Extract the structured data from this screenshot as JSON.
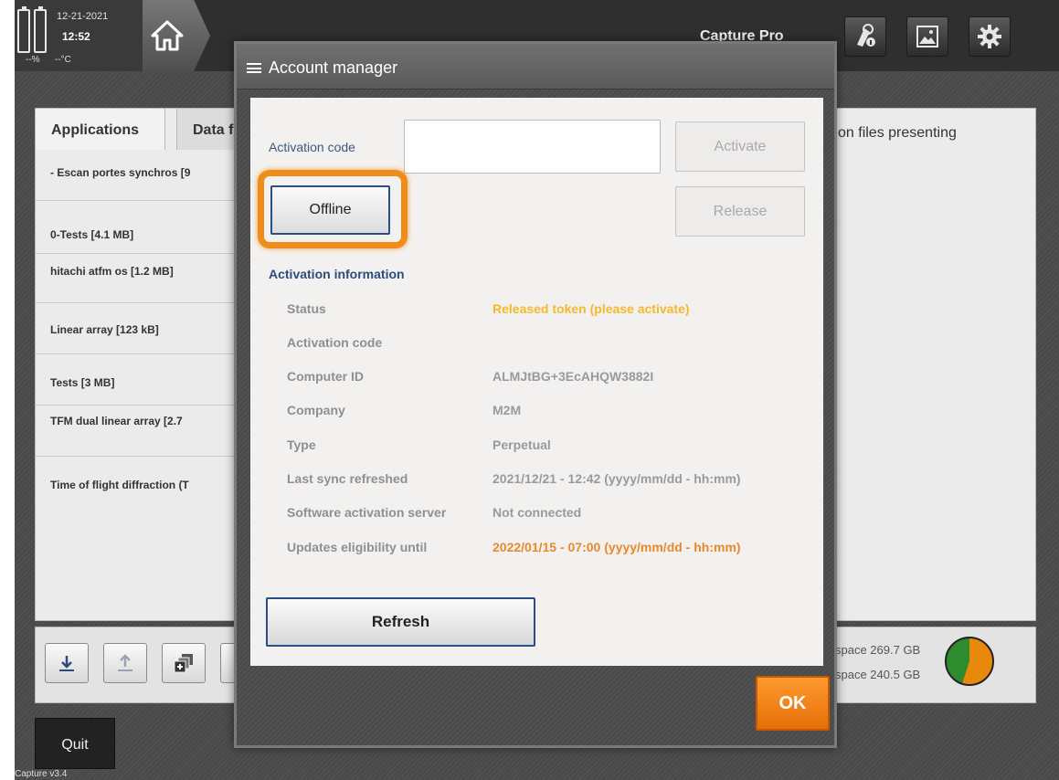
{
  "status_bar": {
    "date": "12-21-2021",
    "time": "12:52",
    "battery_pct": "--%",
    "temperature": "--°C"
  },
  "app_title": "Capture Pro",
  "tabs": [
    {
      "label": "Applications"
    },
    {
      "label": "Data f"
    }
  ],
  "applications_list": [
    "- Escan portes synchros [9",
    "0-Tests [4.1  MB]",
    "hitachi atfm os [1.2  MB]",
    "Linear array [123  kB]",
    "Tests [3  MB]",
    "TFM dual linear array [2.7",
    "Time of flight diffraction (T"
  ],
  "right_panel_text": "on files presenting",
  "storage": {
    "line1": "space 269.7  GB",
    "line2": "space 240.5  GB",
    "used_fraction": 0.45,
    "colors": {
      "used": "#2e8b2e",
      "free": "#e8890c"
    }
  },
  "quit_label": "Quit",
  "version": "Capture v3.4",
  "modal": {
    "title": "Account manager",
    "activation_code_label": "Activation code",
    "activation_code_value": "",
    "activate_label": "Activate",
    "offline_label": "Offline",
    "release_label": "Release",
    "info_heading": "Activation information",
    "info_rows": [
      {
        "label": "Status",
        "value": "Released token (please activate)",
        "color": "#f5b82e"
      },
      {
        "label": "Activation code",
        "value": "",
        "color": "#9a9a9a"
      },
      {
        "label": "Computer ID",
        "value": "ALMJtBG+3EcAHQW3882I",
        "color": "#9a9a9a"
      },
      {
        "label": "Company",
        "value": "M2M",
        "color": "#9a9a9a"
      },
      {
        "label": "Type",
        "value": "Perpetual",
        "color": "#9a9a9a"
      },
      {
        "label": "Last sync refreshed",
        "value": "2021/12/21 - 12:42 (yyyy/mm/dd - hh:mm)",
        "color": "#9a9a9a"
      },
      {
        "label": "Software activation server",
        "value": "Not connected",
        "color": "#9a9a9a"
      },
      {
        "label": "Updates eligibility until",
        "value": "2022/01/15 - 07:00 (yyyy/mm/dd - hh:mm)",
        "color": "#e8892b"
      }
    ],
    "refresh_label": "Refresh",
    "ok_label": "OK"
  },
  "colors": {
    "accent_orange": "#f08c1a",
    "link_blue": "#2a4d80"
  }
}
